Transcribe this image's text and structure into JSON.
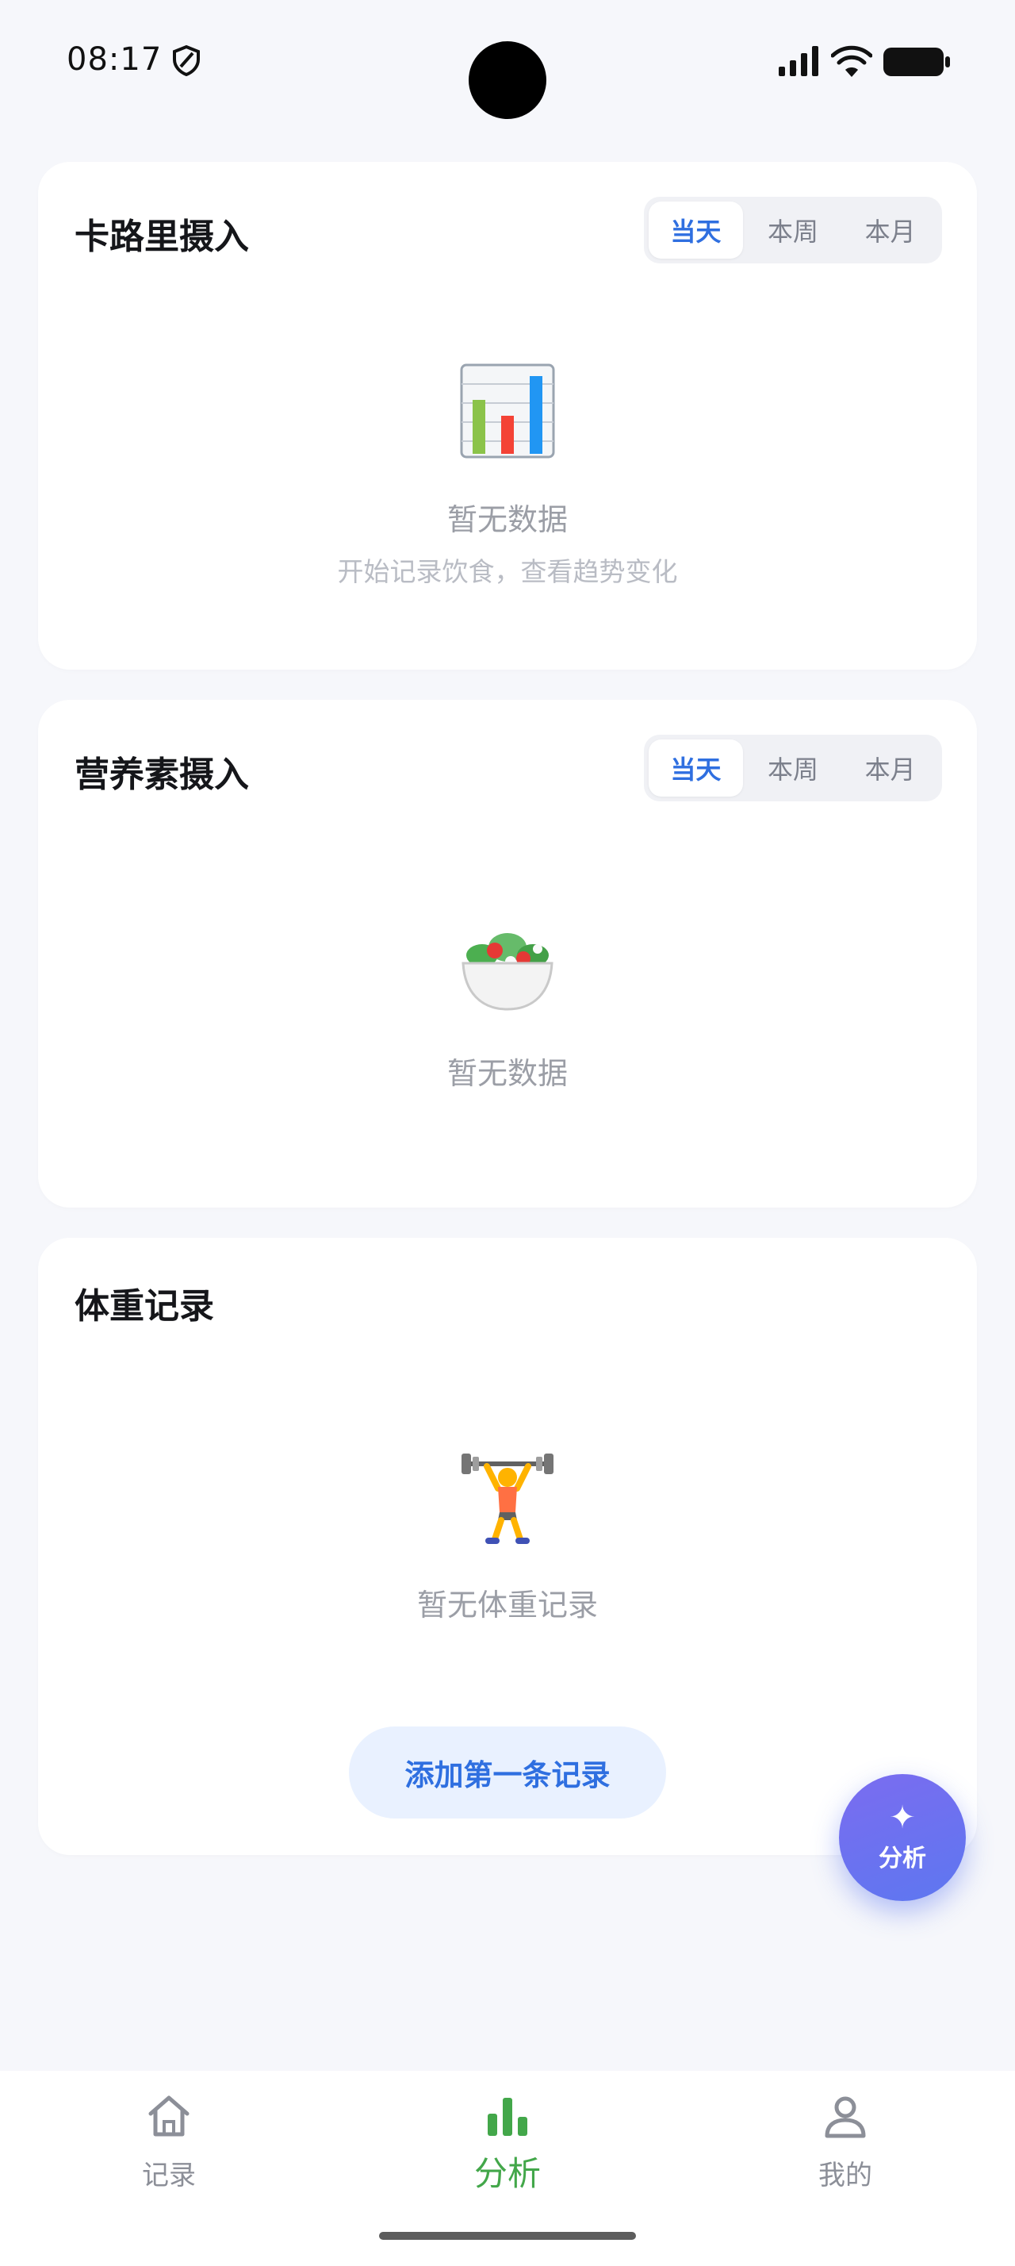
{
  "status_bar": {
    "time": "08:17"
  },
  "calorie_card": {
    "title": "卡路里摄入",
    "segments": [
      "当天",
      "本周",
      "本月"
    ],
    "active_segment": "当天",
    "empty_text": "暂无数据",
    "empty_subtext": "开始记录饮食，查看趋势变化",
    "icon": "bar-chart-icon"
  },
  "nutrient_card": {
    "title": "营养素摄入",
    "segments": [
      "当天",
      "本周",
      "本月"
    ],
    "active_segment": "当天",
    "empty_text": "暂无数据",
    "icon": "salad-icon"
  },
  "weight_card": {
    "title": "体重记录",
    "empty_text": "暂无体重记录",
    "add_button": "添加第一条记录",
    "icon": "weightlifter-icon"
  },
  "fab": {
    "label": "分析",
    "icon": "sparkle-icon"
  },
  "bottom_nav": {
    "items": [
      {
        "label": "记录",
        "icon": "home-icon"
      },
      {
        "label": "分析",
        "icon": "bar-chart-icon",
        "active": true
      },
      {
        "label": "我的",
        "icon": "user-icon"
      }
    ]
  },
  "colors": {
    "accent": "#2f6fe0",
    "nav_active": "#43a74a",
    "fab_start": "#7b6cf0",
    "fab_end": "#5d77f0",
    "background": "#f6f7fb"
  }
}
